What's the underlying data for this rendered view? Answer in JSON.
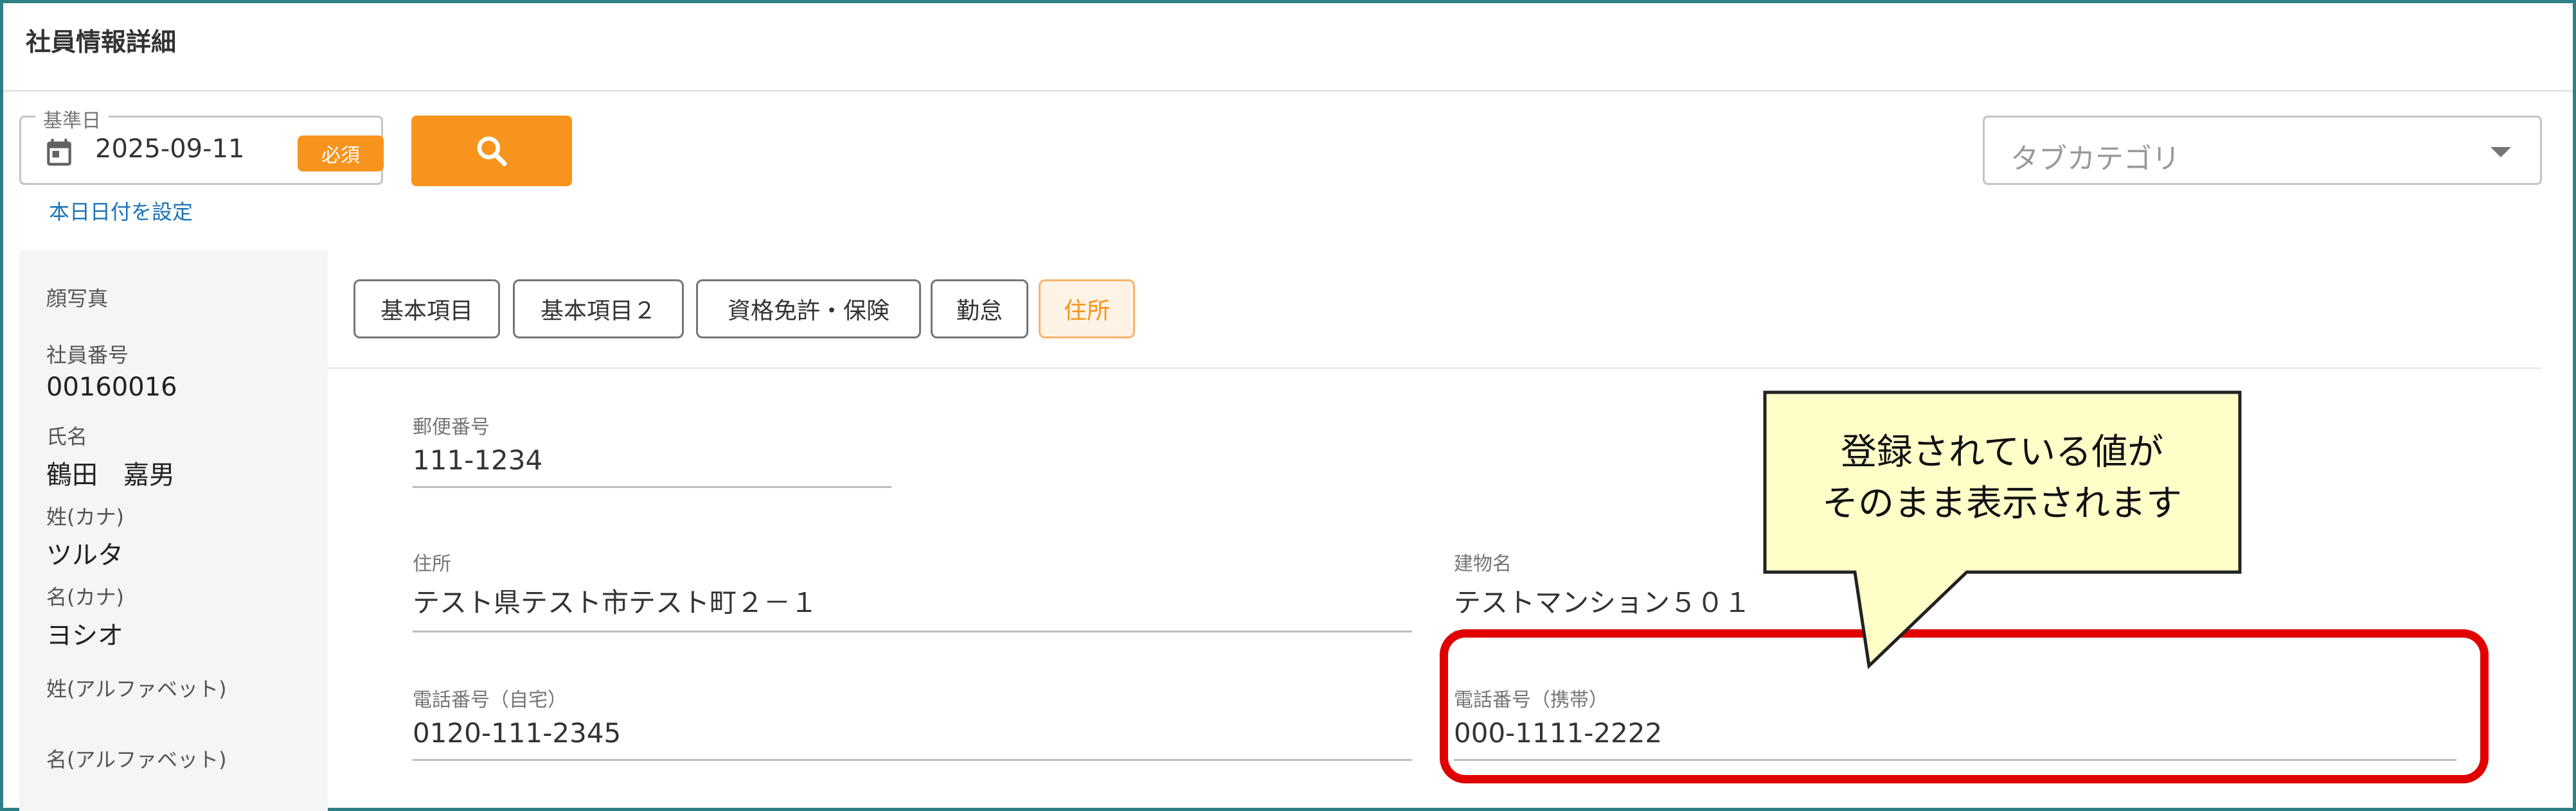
{
  "page": {
    "title": "社員情報詳細"
  },
  "search": {
    "date_legend": "基準日",
    "date_value": "2025-09-11",
    "required_badge": "必須",
    "today_link": "本日日付を設定",
    "tab_category_placeholder": "タブカテゴリ",
    "search_icon": "search-icon"
  },
  "employee": {
    "photo_label": "顔写真",
    "number_label": "社員番号",
    "number_value": "00160016",
    "name_label": "氏名",
    "name_value": "鶴田　嘉男",
    "kana_last_label": "姓(カナ)",
    "kana_last_value": "ツルタ",
    "kana_first_label": "名(カナ)",
    "kana_first_value": "ヨシオ",
    "alpha_last_label": "姓(アルファベット)",
    "alpha_first_label": "名(アルファベット)"
  },
  "tabs": [
    {
      "label": "基本項目"
    },
    {
      "label": "基本項目２"
    },
    {
      "label": "資格免許・保険"
    },
    {
      "label": "勤怠"
    },
    {
      "label": "住所",
      "active": true
    }
  ],
  "address": {
    "postal_label": "郵便番号",
    "postal_value": "111-1234",
    "address_label": "住所",
    "address_value": "テスト県テスト市テスト町２－１",
    "building_label": "建物名",
    "building_value": "テストマンション５０１",
    "phone_home_label": "電話番号（自宅）",
    "phone_home_value": "0120-111-2345",
    "phone_mobile_label": "電話番号（携帯）",
    "phone_mobile_value": "000-1111-2222"
  },
  "callout": {
    "line1": "登録されている値が",
    "line2": "そのまま表示されます"
  },
  "colors": {
    "accent": "#f7941d",
    "highlight": "#e00000",
    "callout_bg": "#fffdc8",
    "link": "#1a73b8",
    "frame": "#2f7f86"
  }
}
